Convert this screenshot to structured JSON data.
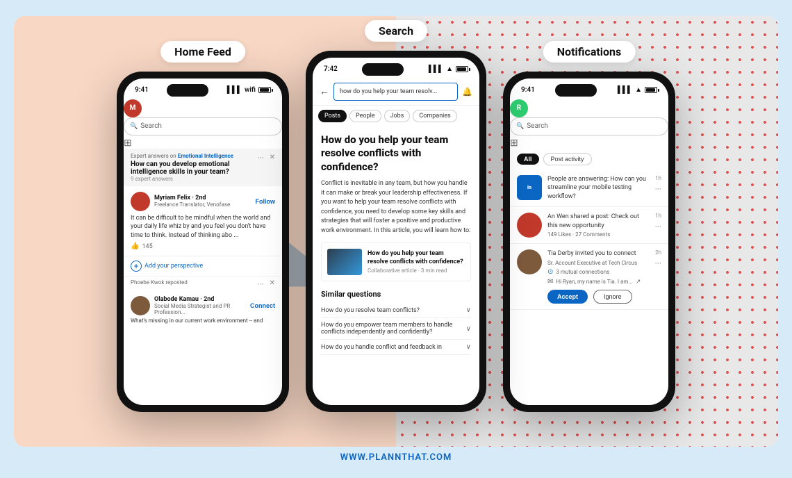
{
  "page": {
    "background_color": "#d6eaf8",
    "footer_url": "WWW.PLANNTHAT.COM"
  },
  "home_feed": {
    "label": "Home Feed",
    "time": "9:41",
    "search_placeholder": "Search",
    "expert_label": "Expert answers on",
    "expert_topic": "Emotional Intelligence",
    "expert_title": "How can you develop emotional intelligence skills in your team?",
    "expert_count": "9 expert answers",
    "poster_name": "Myriam Felix · 2nd",
    "poster_sub": "Freelance Translator, Venofase",
    "follow_label": "Follow",
    "post_text": "It can be difficult to be mindful when the world and your daily life whiz by and you feel you don't have time to think. Instead of thinking abo ...",
    "like_count": "145",
    "add_perspective": "Add your perspective",
    "repost_text": "Phoebe Kwok reposted",
    "poster2_name": "Olabode Kamau · 2nd",
    "poster2_sub": "Social Media Strategist and PR Profession...",
    "connect_label": "Connect",
    "post2_text": "What's missing in our current work environment -- and"
  },
  "search_screen": {
    "label": "Search",
    "time": "7:42",
    "search_value": "how do you help your team resolv...",
    "filter_tabs": [
      "Posts",
      "People",
      "Jobs",
      "Companies"
    ],
    "active_tab": "Posts",
    "article_title": "How do you help your team resolve conflicts with confidence?",
    "article_body": "Conflict is inevitable in any team, but how you handle it can make or break your leadership effectiveness. If you want to help your team resolve conflicts with confidence, you need to develop some key skills and strategies that will foster a positive and productive work environment. In this article, you will learn how to:",
    "article_thumb_title": "How do you help your team resolve conflicts with confidence?",
    "article_thumb_sub": "Collaborative article · 3 min read",
    "similar_label": "Similar questions",
    "similar_q1": "How do you resolve team conflicts?",
    "similar_q2": "How do you empower team members to handle conflicts independently and confidently?",
    "similar_q3": "How do you handle conflict and feedback in"
  },
  "notifications": {
    "label": "Notifications",
    "time": "9:41",
    "search_placeholder": "Search",
    "all_label": "All",
    "post_activity_label": "Post activity",
    "notif1_text": "People are answering: How can you streamline your mobile testing workflow?",
    "notif1_time": "1h",
    "notif2_name": "An Wen",
    "notif2_text": "An Wen shared a post: Check out this new opportunity",
    "notif2_sub": "149 Likes · 27 Comments",
    "notif2_time": "1h",
    "notif3_name": "Tia Derby",
    "notif3_text": "Tia Derby invited you to connect",
    "notif3_sub": "Sr. Account Executive at Tech Circus",
    "notif3_mutual": "3 mutual connections",
    "notif3_time": "2h",
    "notif3_message": "Hi Ryan, my name is Tia. I am...",
    "accept_label": "Accept",
    "ignore_label": "Ignore"
  }
}
